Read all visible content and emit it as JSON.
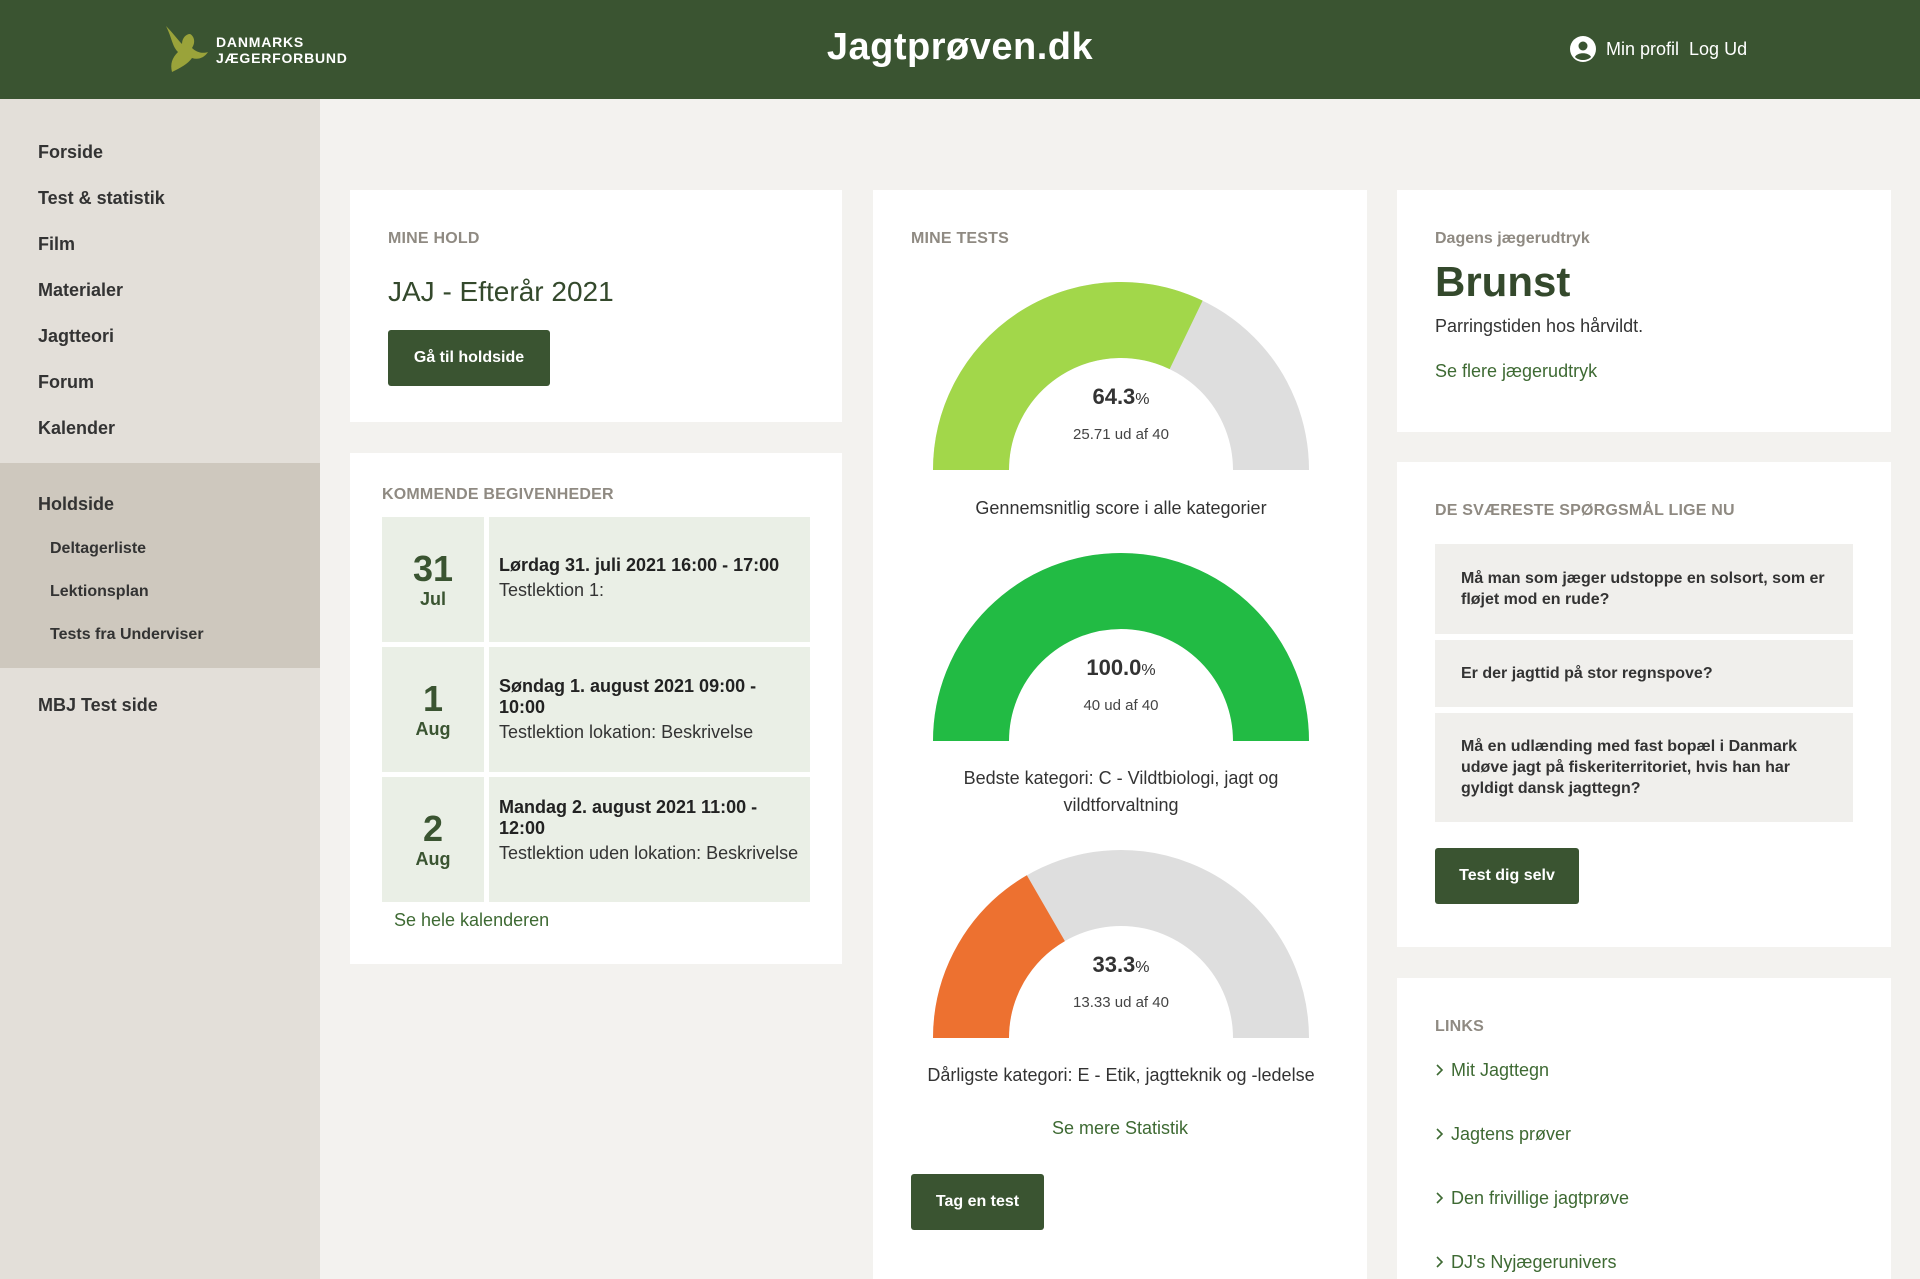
{
  "header": {
    "logo_line1": "DANMARKS",
    "logo_line2": "JÆGERFORBUND",
    "site_title": "Jagtprøven.dk",
    "profile_label": "Min profil",
    "logout_label": "Log Ud"
  },
  "sidebar": {
    "items": [
      "Forside",
      "Test & statistik",
      "Film",
      "Materialer",
      "Jagtteori",
      "Forum",
      "Kalender"
    ],
    "group_title": "Holdside",
    "group_items": [
      "Deltagerliste",
      "Lektionsplan",
      "Tests fra Underviser"
    ],
    "after_item": "MBJ Test side"
  },
  "mine_hold": {
    "eyebrow": "MINE HOLD",
    "team_name": "JAJ - Efterår 2021",
    "button_label": "Gå til holdside"
  },
  "events": {
    "eyebrow": "KOMMENDE BEGIVENHEDER",
    "items": [
      {
        "day": "31",
        "month": "Jul",
        "time": "Lørdag 31. juli 2021 16:00 - 17:00",
        "desc": "Testlektion 1:"
      },
      {
        "day": "1",
        "month": "Aug",
        "time": "Søndag 1. august 2021 09:00 - 10:00",
        "desc": "Testlektion lokation: Beskrivelse"
      },
      {
        "day": "2",
        "month": "Aug",
        "time": "Mandag 2. august 2021 11:00 - 12:00",
        "desc": "Testlektion uden lokation: Beskrivelse"
      }
    ],
    "calendar_link": "Se hele kalenderen"
  },
  "tests": {
    "eyebrow": "MINE TESTS",
    "gauges": [
      {
        "pct": "64.3",
        "pct_unit": "%",
        "value": 0.643,
        "sub": "25.71 ud af 40",
        "caption": "Gennemsnitlig score i alle kategorier",
        "color": "#a2d74a"
      },
      {
        "pct": "100.0",
        "pct_unit": "%",
        "value": 1.0,
        "sub": "40 ud af 40",
        "caption": "Bedste kategori: C - Vildtbiologi, jagt og vildtforvaltning",
        "color": "#22bb44"
      },
      {
        "pct": "33.3",
        "pct_unit": "%",
        "value": 0.333,
        "sub": "13.33 ud af 40",
        "caption": "Dårligste kategori: E - Etik, jagtteknik og -ledelse",
        "color": "#ed7130"
      }
    ],
    "track_color": "#dedede",
    "stats_link": "Se mere Statistik",
    "button_label": "Tag en test"
  },
  "word_of_day": {
    "label": "Dagens jægerudtryk",
    "word": "Brunst",
    "definition": "Parringstiden hos hårvildt.",
    "link": "Se flere jægerudtryk"
  },
  "hard_questions": {
    "eyebrow": "DE SVÆRESTE SPØRGSMÅL LIGE NU",
    "items": [
      "Må man som jæger udstoppe en solsort, som er fløjet mod en rude?",
      "Er der jagttid på stor regnspove?",
      "Må en udlænding med fast bopæl i Danmark udøve jagt på fiskeriterritoriet, hvis han har gyldigt dansk jagttegn?"
    ],
    "button_label": "Test dig selv"
  },
  "links": {
    "eyebrow": "LINKS",
    "items": [
      "Mit Jagttegn",
      "Jagtens prøver",
      "Den frivillige jagtprøve",
      "DJ's Nyjægerunivers"
    ]
  }
}
